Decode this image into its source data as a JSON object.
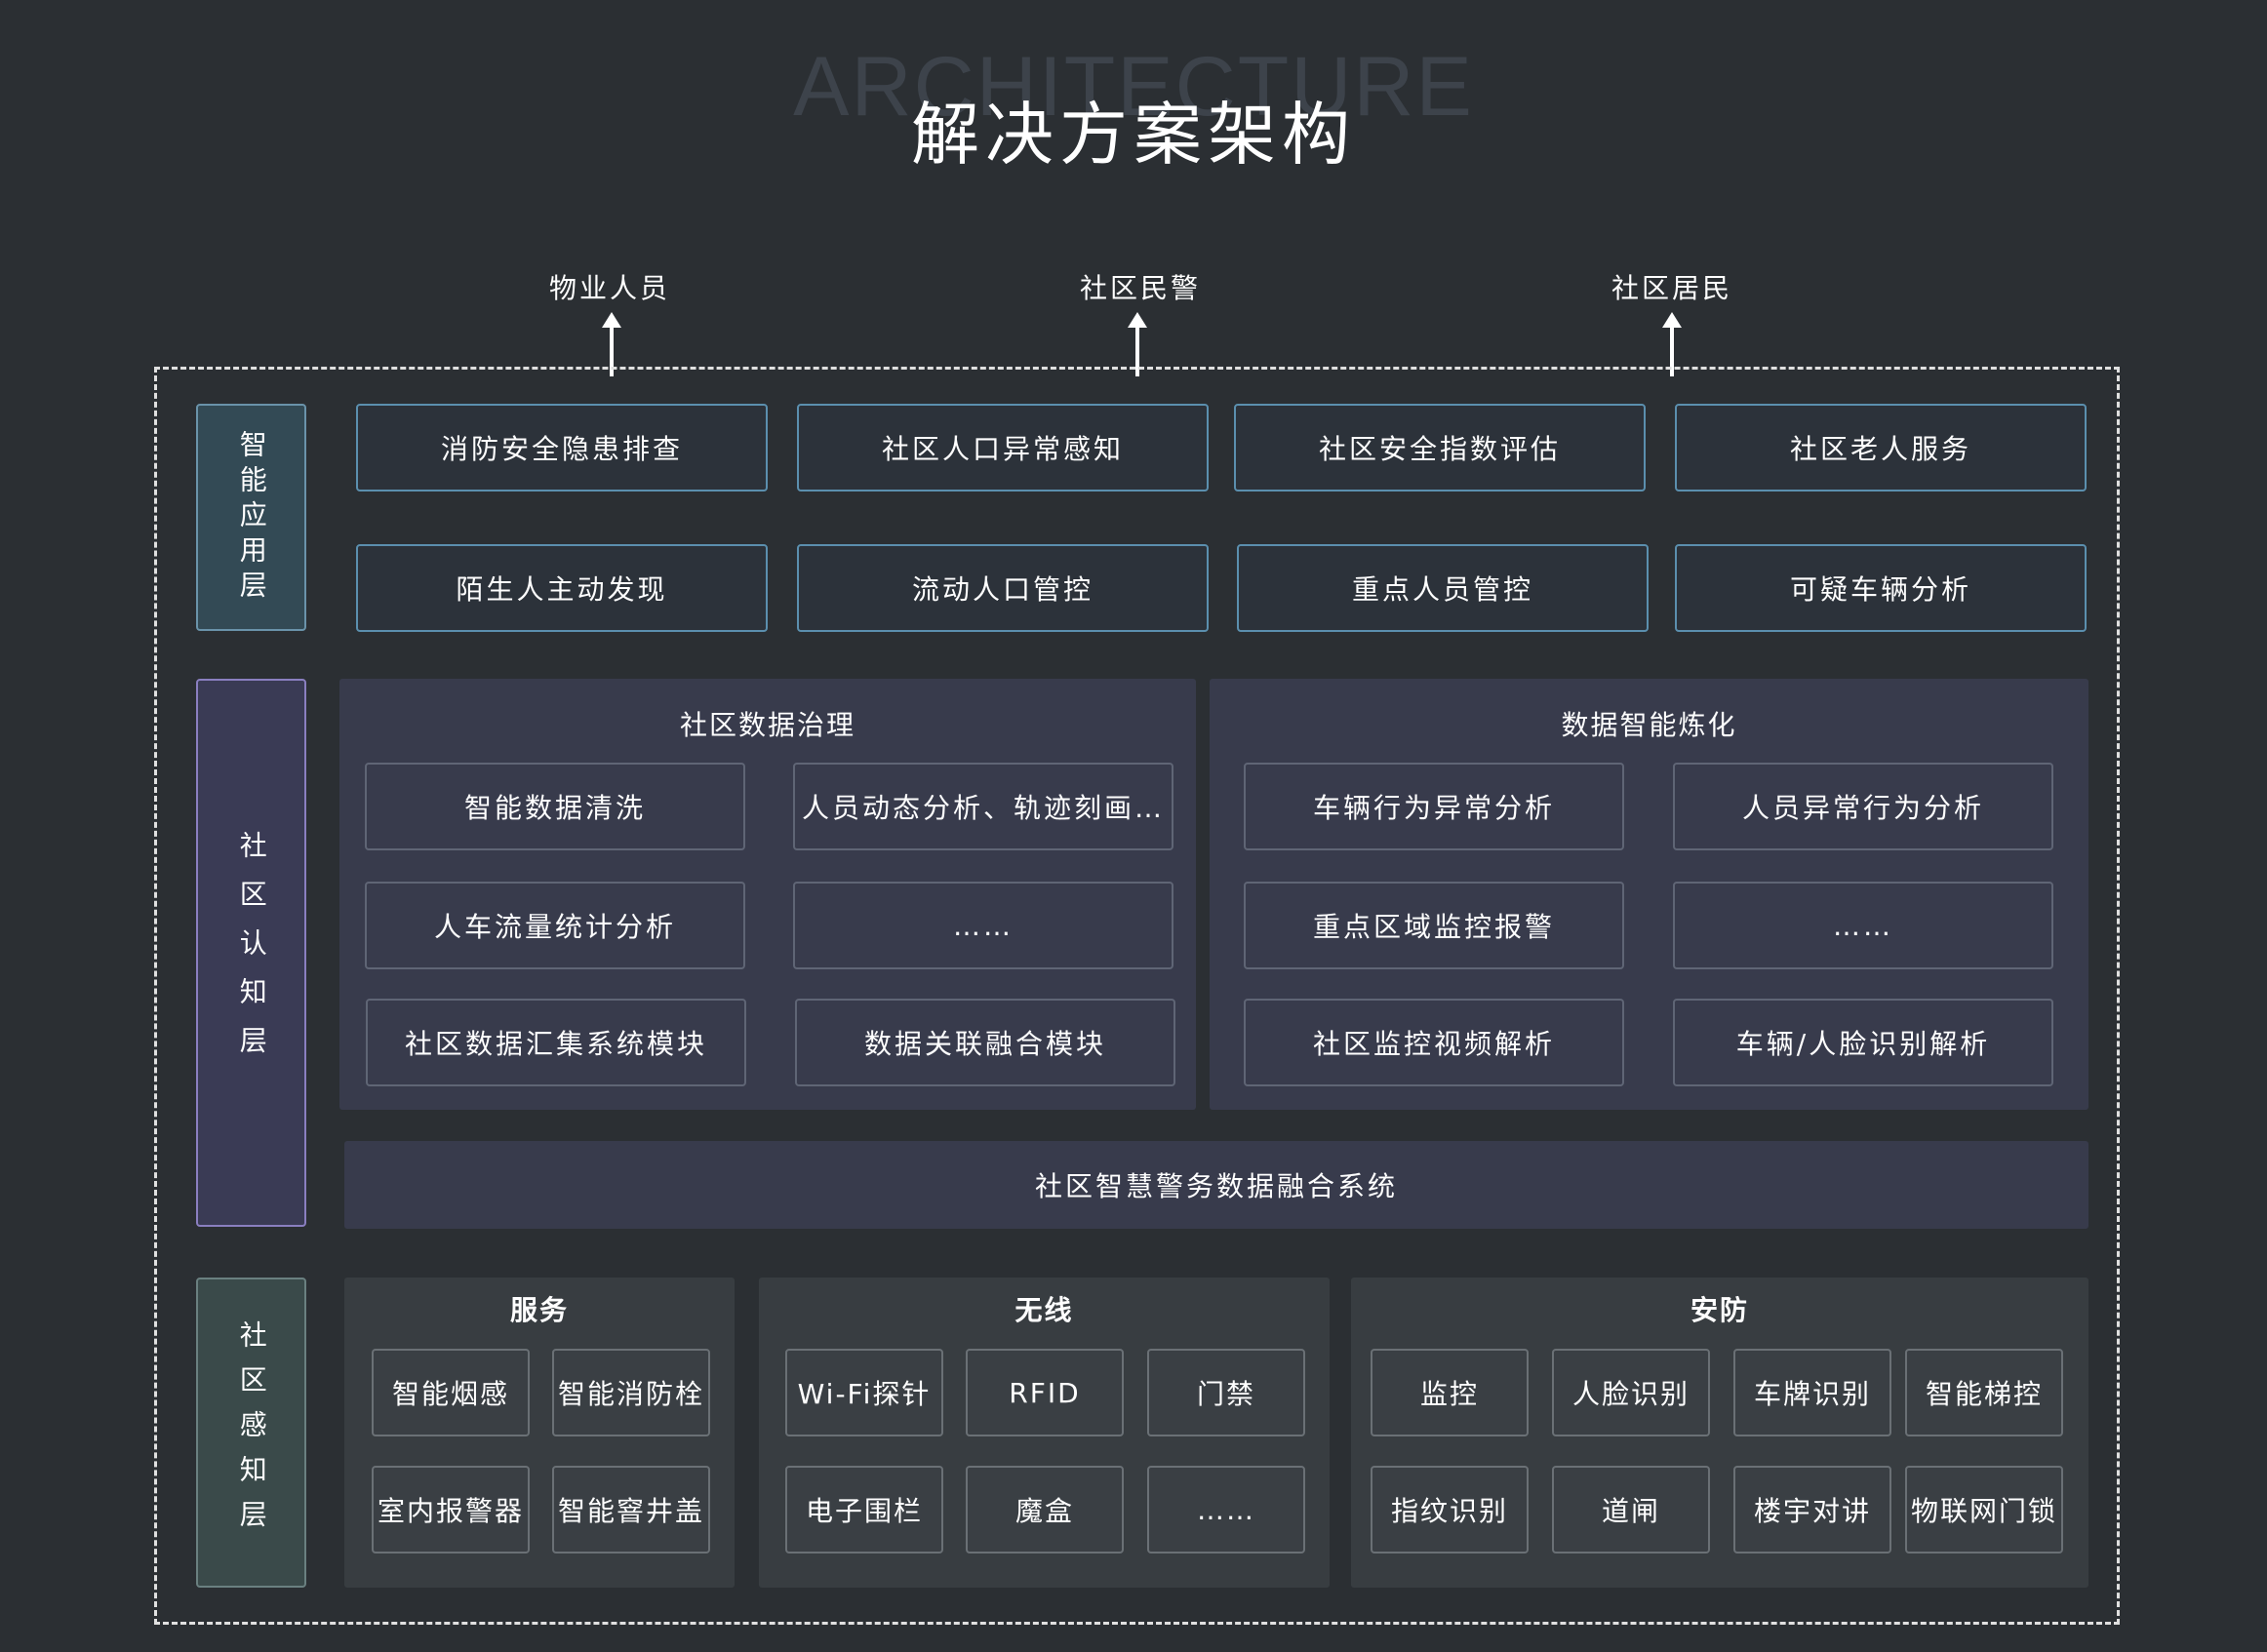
{
  "header": {
    "bg_title": "ARCHITECTURE",
    "title": "解决方案架构"
  },
  "roles": [
    "物业人员",
    "社区民警",
    "社区居民"
  ],
  "layers": {
    "app": "智能应用层",
    "cognition": "社区认知层",
    "perception": "社区感知层"
  },
  "app_items": [
    "消防安全隐患排查",
    "社区人口异常感知",
    "社区安全指数评估",
    "社区老人服务",
    "陌生人主动发现",
    "流动人口管控",
    "重点人员管控",
    "可疑车辆分析"
  ],
  "cognition": {
    "governance": {
      "title": "社区数据治理",
      "items": [
        "智能数据清洗",
        "人员动态分析、轨迹刻画…",
        "人车流量统计分析",
        "……",
        "社区数据汇集系统模块",
        "数据关联融合模块"
      ]
    },
    "refining": {
      "title": "数据智能炼化",
      "items": [
        "车辆行为异常分析",
        "人员异常行为分析",
        "重点区域监控报警",
        "……",
        "社区监控视频解析",
        "车辆/人脸识别解析"
      ]
    },
    "fusion": "社区智慧警务数据融合系统"
  },
  "perception": {
    "service": {
      "title": "服务",
      "items": [
        "智能烟感",
        "智能消防栓",
        "室内报警器",
        "智能窨井盖"
      ]
    },
    "wireless": {
      "title": "无线",
      "items": [
        "Wi-Fi探针",
        "RFID",
        "门禁",
        "电子围栏",
        "魔盒",
        "……"
      ]
    },
    "security": {
      "title": "安防",
      "items": [
        "监控",
        "人脸识别",
        "车牌识别",
        "智能梯控",
        "指纹识别",
        "道闸",
        "楼宇对讲",
        "物联网门锁"
      ]
    }
  },
  "colors": {
    "background": "#2b2f33",
    "app_border": "#5b8fae",
    "cognition_panel": "#383b4c",
    "cognition_label_border": "#8a7fc0"
  }
}
